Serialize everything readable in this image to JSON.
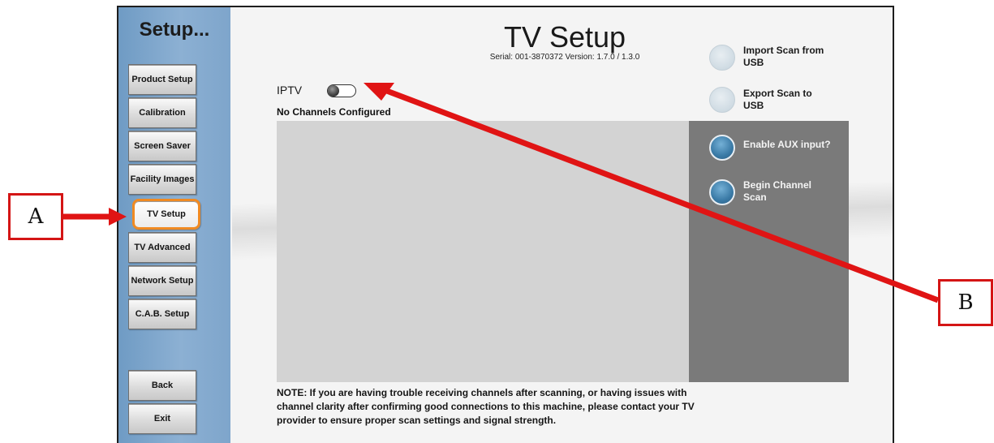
{
  "sidebar": {
    "title": "Setup...",
    "items": [
      {
        "label": "Product Setup"
      },
      {
        "label": "Calibration"
      },
      {
        "label": "Screen Saver"
      },
      {
        "label": "Facility Images"
      },
      {
        "label": "TV Setup"
      },
      {
        "label": "TV Advanced"
      },
      {
        "label": "Network Setup"
      },
      {
        "label": "C.A.B. Setup"
      }
    ],
    "back_label": "Back",
    "exit_label": "Exit",
    "active_item": "TV Setup"
  },
  "header": {
    "title": "TV Setup",
    "serial_line": "Serial: 001-3870372  Version: 1.7.0 / 1.3.0"
  },
  "iptv": {
    "label": "IPTV",
    "toggle_state": "off",
    "status": "No Channels Configured"
  },
  "actions": {
    "import_label": "Import Scan from USB",
    "export_label": "Export Scan to USB",
    "aux_label": "Enable AUX input?",
    "scan_label": "Begin Channel Scan"
  },
  "note": "NOTE: If you are having trouble receiving channels after scanning, or having issues with channel clarity after confirming good connections to this machine, please contact your TV provider to ensure proper scan settings and signal strength.",
  "callouts": {
    "a_label": "A",
    "b_label": "B"
  },
  "colors": {
    "sidebar_blue": "#7ea5cb",
    "active_highlight": "#f08a22",
    "callout_red": "#d41515",
    "panel_gray": "#7a7a7a",
    "list_gray": "#d3d3d3"
  }
}
